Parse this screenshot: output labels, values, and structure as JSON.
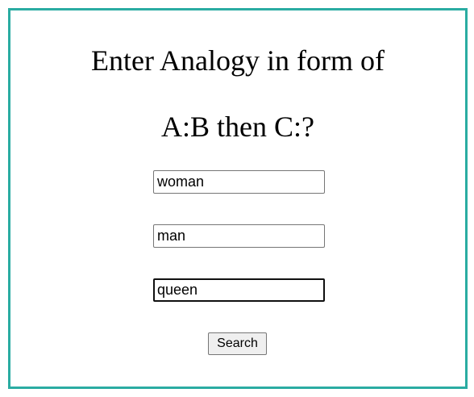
{
  "heading": {
    "line1": "Enter Analogy in form of",
    "line2": "A:B then C:?"
  },
  "form": {
    "word_a": "woman",
    "word_b": "man",
    "word_c": "queen",
    "search_label": "Search"
  },
  "colors": {
    "frame_border": "#2aaca2"
  }
}
